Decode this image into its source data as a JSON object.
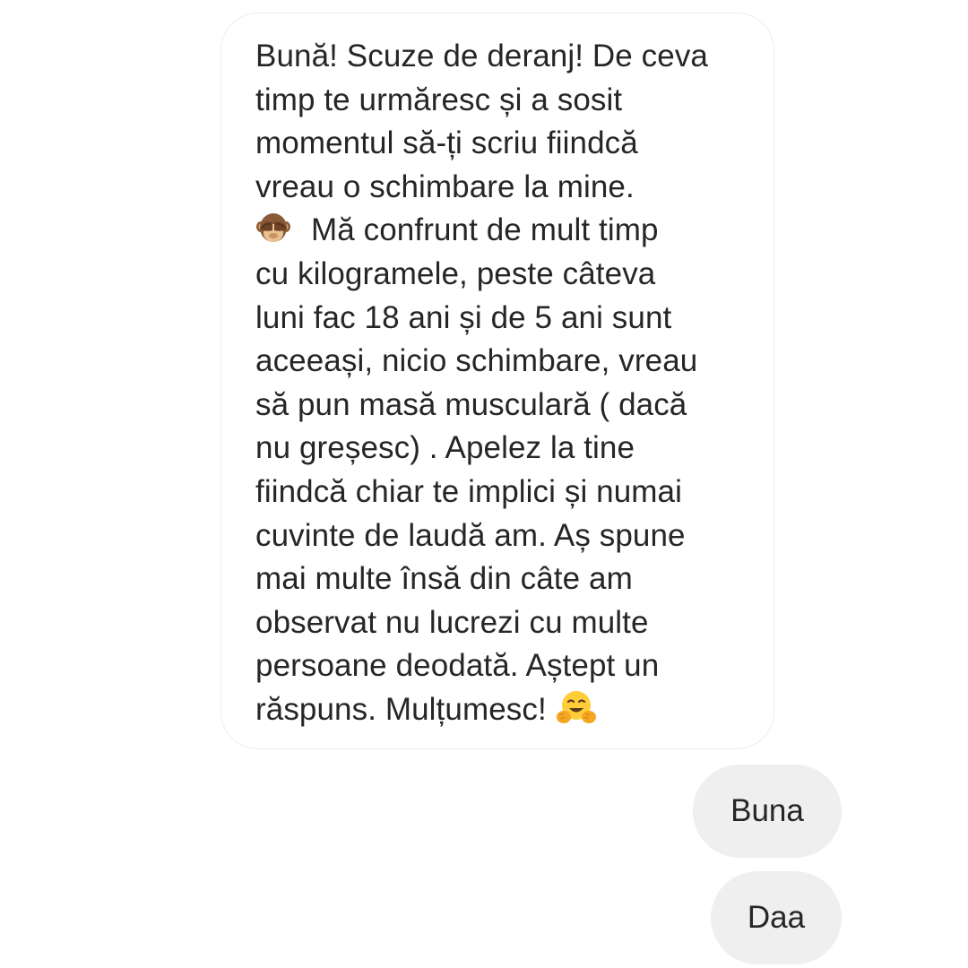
{
  "conversation": {
    "incoming": {
      "lines": [
        "Bună! Scuze de deranj! De ceva",
        "timp te urmăresc și a sosit",
        "momentul să-ți scriu fiindcă",
        "vreau o schimbare la mine.",
        "Mă confrunt de mult timp",
        "cu kilogramele, peste câteva",
        "luni fac 18 ani și de 5 ani sunt",
        "aceeași, nicio schimbare, vreau",
        "să pun masă musculară ( dacă",
        "nu greșesc) . Apelez la tine",
        "fiindcă chiar te implici și numai",
        "cuvinte de laudă am. Aș spune",
        "mai multe însă din câte am",
        "observat nu lucrezi cu multe",
        "persoane deodată. Aștept un",
        "răspuns. Mulțumesc!"
      ],
      "emoji_after_line_4": "see-no-evil-monkey-icon",
      "emoji_end": "hugging-face-icon"
    },
    "outgoing": [
      {
        "text": "Buna"
      },
      {
        "text": "Daa"
      }
    ]
  },
  "colors": {
    "background": "#ffffff",
    "incoming_bubble_border": "#ececec",
    "outgoing_bubble": "#efefef",
    "text": "#262626"
  }
}
